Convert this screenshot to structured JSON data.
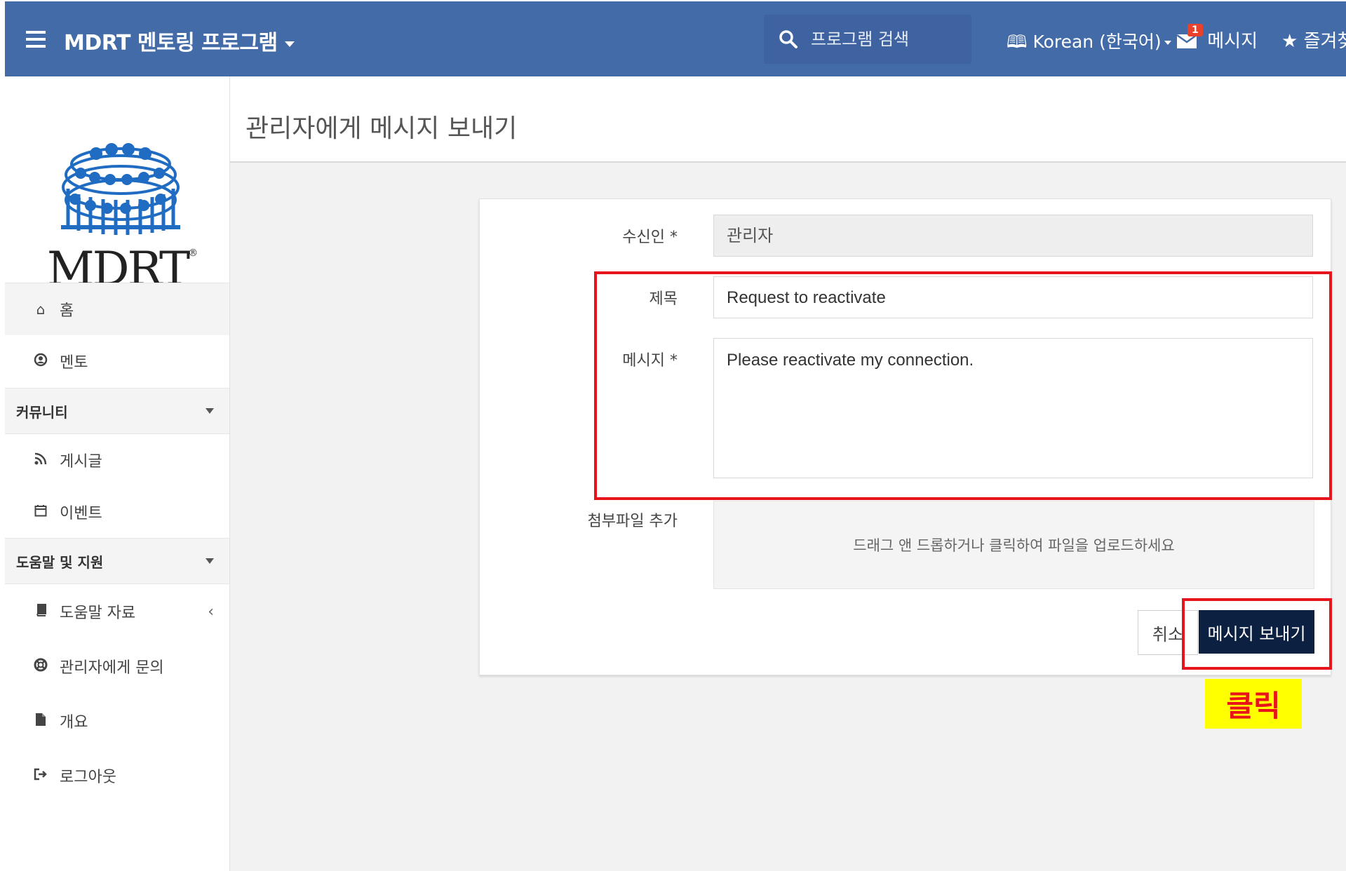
{
  "topbar": {
    "brand": "MDRT 멘토링 프로그램",
    "search_placeholder": "프로그램 검색",
    "language": "Korean (한국어)",
    "messages_label": "메시지",
    "messages_badge": "1",
    "favorites_label": "즐겨찾"
  },
  "sidebar": {
    "logo_text": "MDRT",
    "logo_mark": "®",
    "items": [
      {
        "label": "홈",
        "icon": "home-icon"
      },
      {
        "label": "멘토",
        "icon": "user-circle-icon"
      }
    ],
    "community": {
      "title": "커뮤니티",
      "items": [
        {
          "label": "게시글",
          "icon": "rss-icon"
        },
        {
          "label": "이벤트",
          "icon": "calendar-icon"
        }
      ]
    },
    "help": {
      "title": "도움말 및 지원",
      "items": [
        {
          "label": "도움말 자료",
          "icon": "book-icon"
        },
        {
          "label": "관리자에게 문의",
          "icon": "lifebuoy-icon"
        },
        {
          "label": "개요",
          "icon": "file-icon"
        },
        {
          "label": "로그아웃",
          "icon": "sign-out-icon"
        }
      ]
    }
  },
  "main": {
    "title": "관리자에게 메시지 보내기",
    "form": {
      "recipient_label": "수신인 *",
      "recipient_value": "관리자",
      "subject_label": "제목",
      "subject_value": "Request to reactivate",
      "message_label": "메시지 *",
      "message_value": "Please reactivate my connection.",
      "attachment_label": "첨부파일 추가",
      "attachment_hint": "드래그 앤 드롭하거나 클릭하여 파일을 업로드하세요",
      "cancel_label": "취소",
      "send_label": "메시지 보내기"
    }
  },
  "annotation": {
    "click_label": "클릭",
    "highlight_color": "#e8141b",
    "callout_bg": "#ffff00"
  },
  "colors": {
    "topbar": "#436ba8",
    "send_button": "#0c2142",
    "logo_blue": "#1f6cc2"
  }
}
